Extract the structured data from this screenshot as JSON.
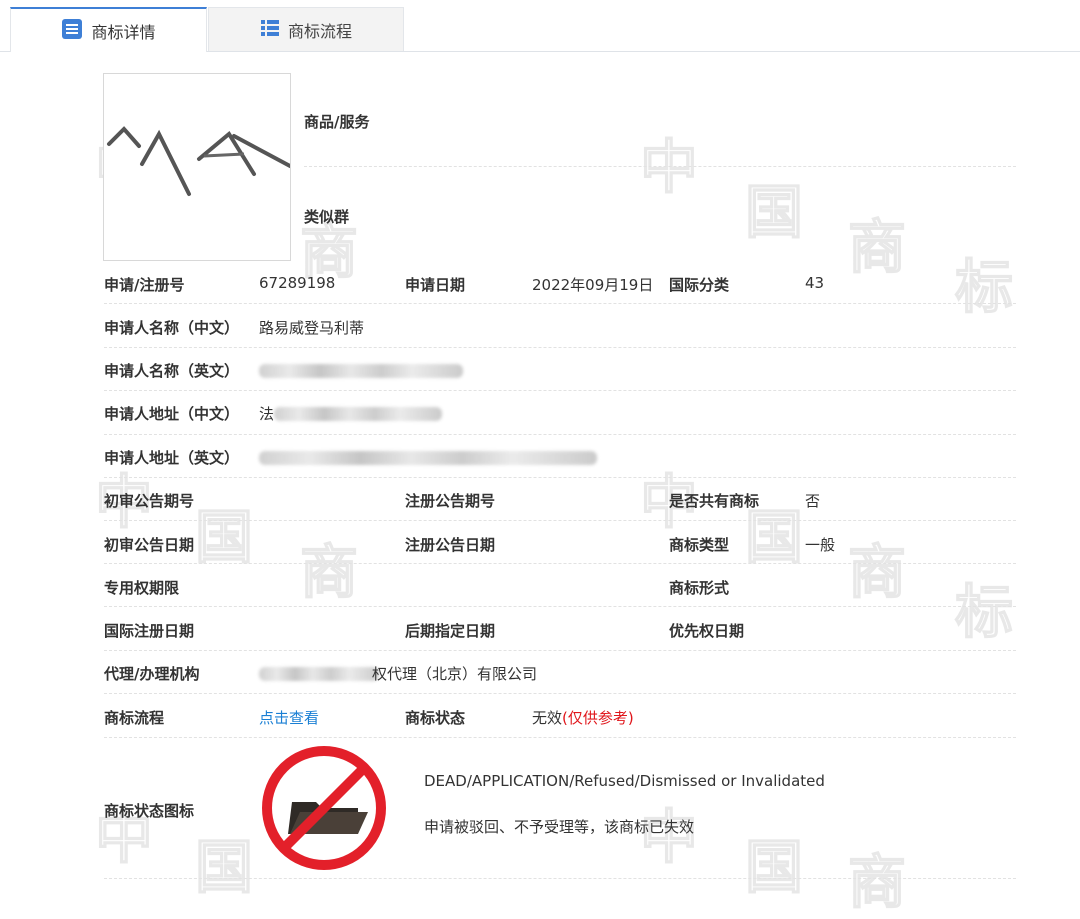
{
  "tabs": {
    "detail": "商标详情",
    "flow": "商标流程"
  },
  "watermark": {
    "chars": [
      "中",
      "国",
      "商",
      "标"
    ]
  },
  "side": {
    "goods_services": "商品/服务",
    "similar_group": "类似群"
  },
  "fields": {
    "reg_no_label": "申请/注册号",
    "reg_no": "67289198",
    "apply_date_label": "申请日期",
    "apply_date": "2022年09月19日",
    "intl_class_label": "国际分类",
    "intl_class": "43",
    "applicant_cn_label": "申请人名称（中文）",
    "applicant_cn": "路易威登马利蒂",
    "applicant_en_label": "申请人名称（英文）",
    "address_cn_label": "申请人地址（中文）",
    "address_cn_visible": "法",
    "address_en_label": "申请人地址（英文）",
    "prelim_no_label": "初审公告期号",
    "reg_pub_no_label": "注册公告期号",
    "shared_label": "是否共有商标",
    "shared": "否",
    "prelim_date_label": "初审公告日期",
    "reg_pub_date_label": "注册公告日期",
    "tm_type_label": "商标类型",
    "tm_type": "一般",
    "exclusive_label": "专用权期限",
    "tm_form_label": "商标形式",
    "intl_reg_date_label": "国际注册日期",
    "later_date_label": "后期指定日期",
    "priority_date_label": "优先权日期",
    "agent_label": "代理/办理机构",
    "agent_visible": "权代理（北京）有限公司",
    "process_label": "商标流程",
    "process_link": "点击查看",
    "status_label": "商标状态",
    "status_value": "无效",
    "status_note": "(仅供参考)",
    "status_icon_label": "商标状态图标",
    "status_en": "DEAD/APPLICATION/Refused/Dismissed or Invalidated",
    "status_cn": "申请被驳回、不予受理等，该商标已失效"
  },
  "colors": {
    "accent": "#3e7fd6",
    "link": "#1a7fd4",
    "red": "#e0161b"
  }
}
